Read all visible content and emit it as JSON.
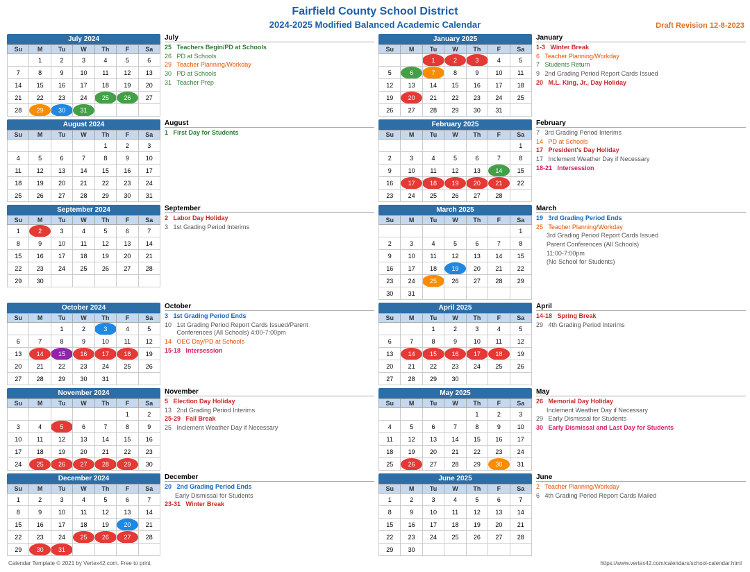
{
  "title": "Fairfield County School District",
  "subtitle": "2024-2025 Modified Balanced Academic Calendar",
  "draft": "Draft Revision 12-8-2023",
  "footer_left": "Calendar Template © 2021 by Vertex42.com. Free to print.",
  "footer_right": "https://www.vertex42.com/calendars/school-calendar.html"
}
